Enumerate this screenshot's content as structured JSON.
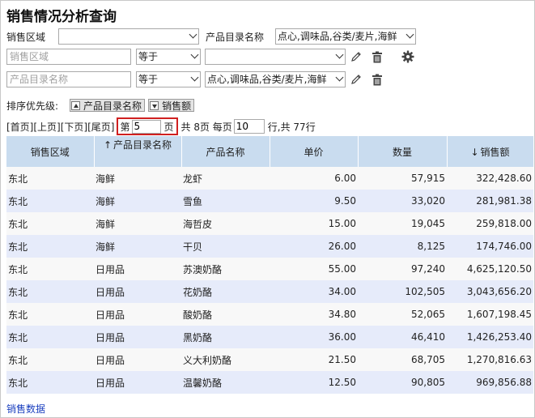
{
  "title": "销售情况分析查询",
  "filter1": {
    "label": "销售区域",
    "region_value": "",
    "category_label": "产品目录名称",
    "category_value": "点心,调味品,谷类/麦片,海鲜"
  },
  "filter2": {
    "placeholder": "销售区域",
    "operator": "等于",
    "value": ""
  },
  "filter3": {
    "placeholder": "产品目录名称",
    "operator": "等于",
    "value": "点心,调味品,谷类/麦片,海鲜"
  },
  "icons": {
    "edit": "pencil-icon",
    "delete": "trash-icon",
    "settings": "gear-icon"
  },
  "sort": {
    "label": "排序优先级:",
    "items": [
      {
        "label": "产品目录名称",
        "direction": "up"
      },
      {
        "label": "销售额",
        "direction": "down"
      }
    ]
  },
  "pager": {
    "first": "[首页]",
    "prev": "[上页]",
    "next": "[下页]",
    "last": "[尾页]",
    "page_prefix": "第",
    "page_value": "5",
    "page_suffix": "页",
    "total_pages_text": "共 8页 每页",
    "per_page_value": "10",
    "total_rows_text": "行,共 77行"
  },
  "table": {
    "headers": [
      "销售区域",
      "产品目录名称",
      "产品名称",
      "单价",
      "数量",
      "销售额"
    ],
    "sort_arrows": {
      "1": "↑",
      "5": "↓"
    },
    "rows": [
      [
        "东北",
        "海鲜",
        "龙虾",
        "6.00",
        "57,915",
        "322,428.60"
      ],
      [
        "东北",
        "海鲜",
        "雪鱼",
        "9.50",
        "33,020",
        "281,981.38"
      ],
      [
        "东北",
        "海鲜",
        "海哲皮",
        "15.00",
        "19,045",
        "259,818.00"
      ],
      [
        "东北",
        "海鲜",
        "干贝",
        "26.00",
        "8,125",
        "174,746.00"
      ],
      [
        "东北",
        "日用品",
        "苏澳奶酪",
        "55.00",
        "97,240",
        "4,625,120.50"
      ],
      [
        "东北",
        "日用品",
        "花奶酪",
        "34.00",
        "102,505",
        "3,043,656.20"
      ],
      [
        "东北",
        "日用品",
        "酸奶酪",
        "34.80",
        "52,065",
        "1,607,198.45"
      ],
      [
        "东北",
        "日用品",
        "黑奶酪",
        "36.00",
        "46,410",
        "1,426,253.40"
      ],
      [
        "东北",
        "日用品",
        "义大利奶酪",
        "21.50",
        "68,705",
        "1,270,816.63"
      ],
      [
        "东北",
        "日用品",
        "温馨奶酪",
        "12.50",
        "90,805",
        "969,856.88"
      ]
    ]
  },
  "footer_link": "销售数据"
}
